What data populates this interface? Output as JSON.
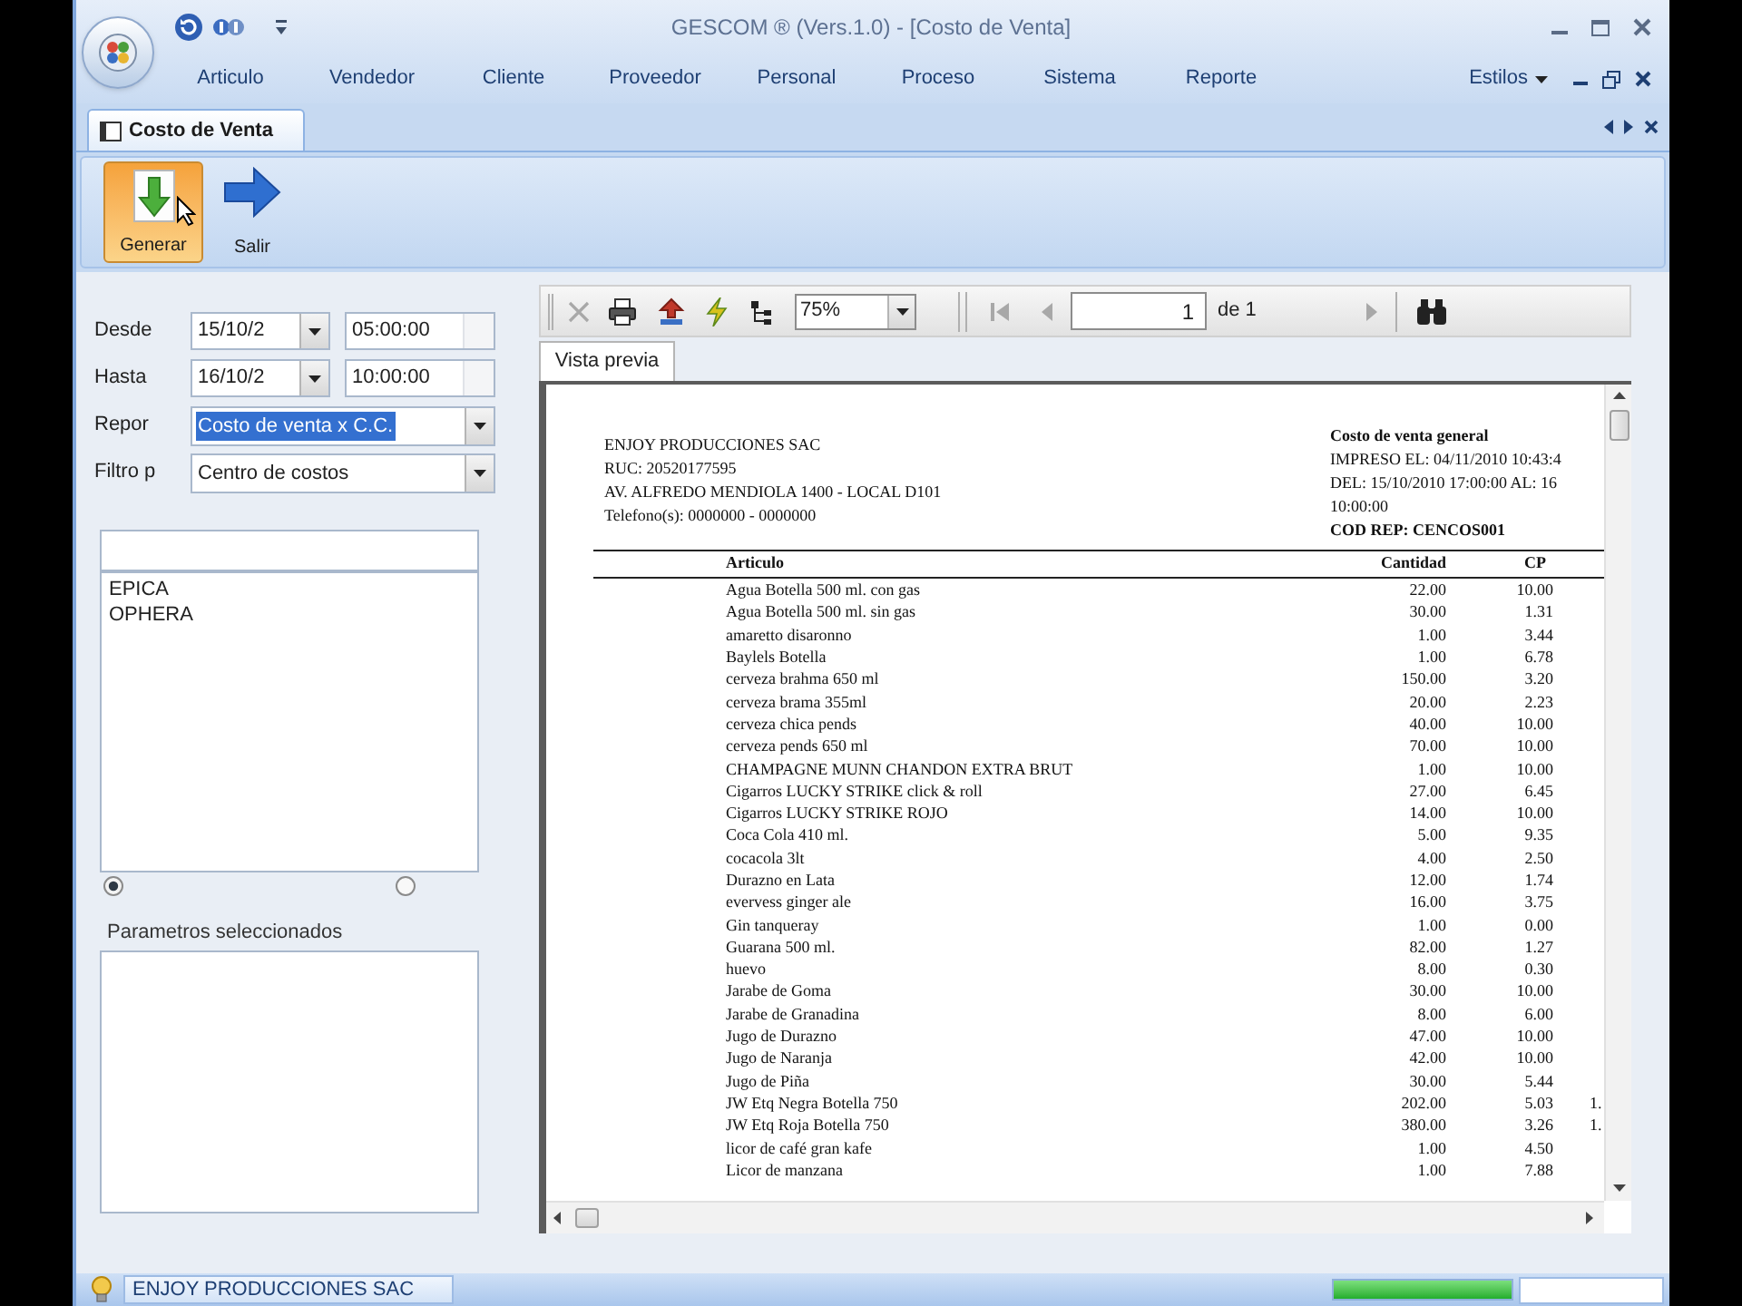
{
  "window": {
    "title": "GESCOM ® (Vers.1.0) - [Costo de Venta]"
  },
  "menu": [
    {
      "label": "Articulo"
    },
    {
      "label": "Vendedor"
    },
    {
      "label": "Cliente"
    },
    {
      "label": "Proveedor"
    },
    {
      "label": "Personal"
    },
    {
      "label": "Proceso"
    },
    {
      "label": "Sistema"
    },
    {
      "label": "Reporte"
    }
  ],
  "styles_menu": {
    "label": "Estilos"
  },
  "document_tabs": [
    {
      "label": "Costo de Venta",
      "selected": true
    }
  ],
  "ribbon_buttons": [
    {
      "label": "Generar",
      "kind": "generate",
      "hovered": true
    },
    {
      "label": "Salir",
      "kind": "exit",
      "hovered": false
    }
  ],
  "filters": [
    {
      "kind": "date",
      "label": "Desde",
      "date": "15/10/2",
      "time": "05:00:00"
    },
    {
      "kind": "date",
      "label": "Hasta",
      "date": "16/10/2",
      "time": "10:00:00"
    },
    {
      "kind": "combo",
      "label": "Repor",
      "value": "Costo de venta x C.C.",
      "highlighted": true
    },
    {
      "kind": "combo",
      "label": "Filtro p",
      "value": "Centro de costos",
      "highlighted": false
    }
  ],
  "list": {
    "items": [
      "EPICA",
      "OPHERA"
    ]
  },
  "radio_options": [
    {
      "selected": true
    },
    {
      "selected": false
    }
  ],
  "selected_params": {
    "label": "Parametros seleccionados"
  },
  "report_toolbar": {
    "zoom": "75%",
    "page": "1",
    "page_count": "de 1"
  },
  "preview_tabs": [
    {
      "label": "Vista previa",
      "selected": true
    }
  ],
  "report": {
    "company_lines": [
      "ENJOY PRODUCCIONES SAC",
      "RUC: 20520177595",
      "AV. ALFREDO MENDIOLA 1400 - LOCAL D101",
      "Telefono(s): 0000000 - 0000000"
    ],
    "title": "Costo de venta general",
    "info_lines": [
      "IMPRESO EL: 04/11/2010 10:43:4",
      "DEL: 15/10/2010 17:00:00 AL: 16",
      "10:00:00"
    ],
    "code": "COD REP: CENCOS001",
    "columns": [
      "Articulo",
      "Cantidad",
      "CP"
    ],
    "rows": [
      {
        "articulo": "Agua Botella 500 ml. con gas",
        "cantidad": "22.00",
        "cp": "10.00"
      },
      {
        "articulo": "Agua Botella 500 ml. sin gas",
        "cantidad": "30.00",
        "cp": "1.31"
      },
      {
        "articulo": "amaretto disaronno",
        "cantidad": "1.00",
        "cp": "3.44"
      },
      {
        "articulo": "Baylels Botella",
        "cantidad": "1.00",
        "cp": "6.78"
      },
      {
        "articulo": "cerveza brahma 650 ml",
        "cantidad": "150.00",
        "cp": "3.20"
      },
      {
        "articulo": "cerveza brama 355ml",
        "cantidad": "20.00",
        "cp": "2.23"
      },
      {
        "articulo": "cerveza chica pends",
        "cantidad": "40.00",
        "cp": "10.00"
      },
      {
        "articulo": "cerveza pends 650 ml",
        "cantidad": "70.00",
        "cp": "10.00"
      },
      {
        "articulo": "CHAMPAGNE MUNN CHANDON EXTRA BRUT",
        "cantidad": "1.00",
        "cp": "10.00"
      },
      {
        "articulo": "Cigarros LUCKY STRIKE click & roll",
        "cantidad": "27.00",
        "cp": "6.45"
      },
      {
        "articulo": "Cigarros LUCKY STRIKE ROJO",
        "cantidad": "14.00",
        "cp": "10.00"
      },
      {
        "articulo": "Coca Cola 410 ml.",
        "cantidad": "5.00",
        "cp": "9.35"
      },
      {
        "articulo": "cocacola 3lt",
        "cantidad": "4.00",
        "cp": "2.50"
      },
      {
        "articulo": "Durazno en Lata",
        "cantidad": "12.00",
        "cp": "1.74"
      },
      {
        "articulo": "evervess ginger ale",
        "cantidad": "16.00",
        "cp": "3.75"
      },
      {
        "articulo": "Gin tanqueray",
        "cantidad": "1.00",
        "cp": "0.00"
      },
      {
        "articulo": "Guarana 500 ml.",
        "cantidad": "82.00",
        "cp": "1.27"
      },
      {
        "articulo": "huevo",
        "cantidad": "8.00",
        "cp": "0.30"
      },
      {
        "articulo": "Jarabe de Goma",
        "cantidad": "30.00",
        "cp": "10.00"
      },
      {
        "articulo": "Jarabe de Granadina",
        "cantidad": "8.00",
        "cp": "6.00"
      },
      {
        "articulo": "Jugo de Durazno",
        "cantidad": "47.00",
        "cp": "10.00"
      },
      {
        "articulo": "Jugo de Naranja",
        "cantidad": "42.00",
        "cp": "10.00"
      },
      {
        "articulo": "Jugo de Piña",
        "cantidad": "30.00",
        "cp": "5.44"
      },
      {
        "articulo": "JW Etq Negra Botella 750",
        "cantidad": "202.00",
        "cp": "5.03",
        "column_4": "1."
      },
      {
        "articulo": "JW Etq Roja Botella 750",
        "cantidad": "380.00",
        "cp": "3.26",
        "column_4": "1."
      },
      {
        "articulo": "licor de café gran kafe",
        "cantidad": "1.00",
        "cp": "4.50"
      },
      {
        "articulo": "Licor de manzana",
        "cantidad": "1.00",
        "cp": "7.88"
      }
    ]
  },
  "status_bar": {
    "company": "ENJOY PRODUCCIONES SAC",
    "progress": {
      "level": 1
    }
  }
}
